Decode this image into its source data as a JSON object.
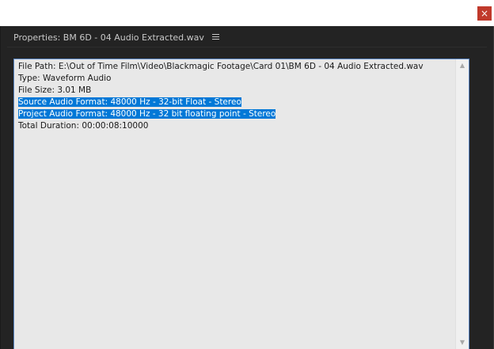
{
  "window": {
    "close_glyph": "×"
  },
  "panel": {
    "title": "Properties: BM 6D - 04 Audio Extracted.wav",
    "menu_icon": "hamburger-menu-icon"
  },
  "properties": {
    "lines": [
      {
        "text": "File Path: E:\\Out of Time Film\\Video\\Blackmagic Footage\\Card 01\\BM 6D - 04 Audio Extracted.wav",
        "selected": false
      },
      {
        "text": "Type: Waveform Audio",
        "selected": false
      },
      {
        "text": "File Size: 3.01 MB",
        "selected": false
      },
      {
        "text": "Source Audio Format: 48000 Hz - 32-bit Float - Stereo",
        "selected": true
      },
      {
        "text": "Project Audio Format: 48000 Hz - 32 bit floating point - Stereo",
        "selected": true
      },
      {
        "text": "Total Duration: 00:00:08:10000",
        "selected": false
      }
    ]
  },
  "scrollbar": {
    "up_glyph": "▲",
    "down_glyph": "▼"
  },
  "colors": {
    "panel_bg": "#232323",
    "textbox_bg": "#e8e8e8",
    "selection": "#0078d7",
    "close_button": "#c0392b",
    "focus_border": "#5b87c4"
  }
}
